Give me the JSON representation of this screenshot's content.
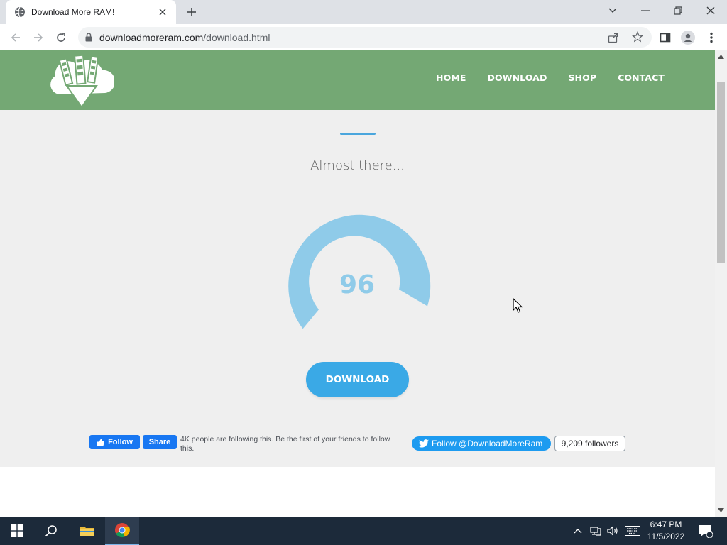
{
  "browser": {
    "tab_title": "Download More RAM!",
    "url_domain": "downloadmoreram.com",
    "url_path": "/download.html"
  },
  "site": {
    "nav": [
      "HOME",
      "DOWNLOAD",
      "SHOP",
      "CONTACT"
    ],
    "subtitle": "Almost there...",
    "progress_value": "96",
    "download_label": "DOWNLOAD",
    "colors": {
      "header": "#74a874",
      "button": "#3aa9e6",
      "gauge": "#8fcbe9",
      "background": "#efefef"
    }
  },
  "social": {
    "fb_follow": "Follow",
    "fb_share": "Share",
    "fb_text": "4K people are following this. Be the first of your friends to follow this.",
    "twitter_follow": "Follow @DownloadMoreRam",
    "twitter_followers": "9,209 followers"
  },
  "taskbar": {
    "time": "6:47 PM",
    "date": "11/5/2022",
    "notification_count": "1"
  }
}
